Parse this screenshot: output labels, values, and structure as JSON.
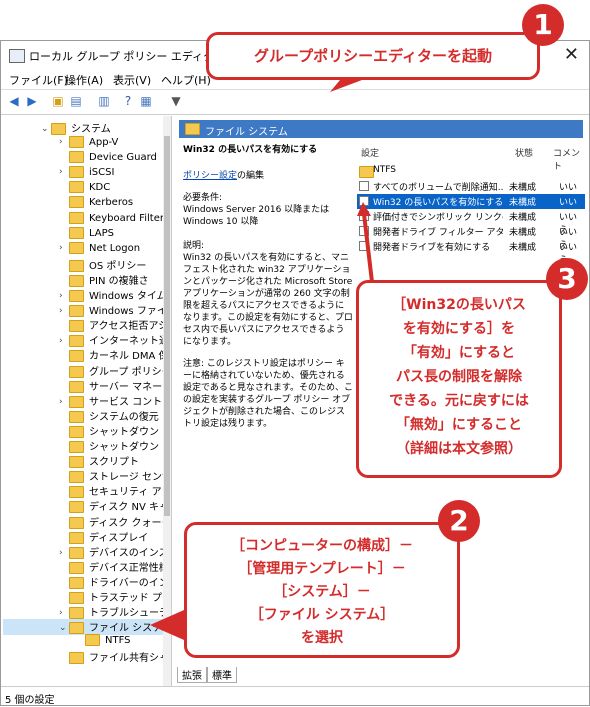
{
  "window": {
    "title": "ローカル グループ ポリシー エディター",
    "close": "✕"
  },
  "menu": [
    "ファイル(F)",
    "操作(A)",
    "表示(V)",
    "ヘルプ(H)"
  ],
  "tree": {
    "root": "システム",
    "items": [
      {
        "label": "App-V",
        "arrow": ">"
      },
      {
        "label": "Device Guard",
        "arrow": ""
      },
      {
        "label": "iSCSI",
        "arrow": ">"
      },
      {
        "label": "KDC",
        "arrow": ""
      },
      {
        "label": "Kerberos",
        "arrow": ""
      },
      {
        "label": "Keyboard Filter",
        "arrow": ""
      },
      {
        "label": "LAPS",
        "arrow": ""
      },
      {
        "label": "Net Logon",
        "arrow": ">"
      },
      {
        "label": "OS ポリシー",
        "arrow": ""
      },
      {
        "label": "PIN の複雑さ",
        "arrow": ""
      },
      {
        "label": "Windows タイム",
        "arrow": ">"
      },
      {
        "label": "Windows ファイル",
        "arrow": ">"
      },
      {
        "label": "アクセス拒否アシ",
        "arrow": ""
      },
      {
        "label": "インターネット通信",
        "arrow": ">"
      },
      {
        "label": "カーネル DMA 保",
        "arrow": ""
      },
      {
        "label": "グループ ポリシー",
        "arrow": ""
      },
      {
        "label": "サーバー マネージャ",
        "arrow": ""
      },
      {
        "label": "サービス コントロー",
        "arrow": ">"
      },
      {
        "label": "システムの復元",
        "arrow": ""
      },
      {
        "label": "シャットダウン",
        "arrow": ""
      },
      {
        "label": "シャットダウン オプ",
        "arrow": ""
      },
      {
        "label": "スクリプト",
        "arrow": ""
      },
      {
        "label": "ストレージ センサー",
        "arrow": ""
      },
      {
        "label": "セキュリティ アカウ",
        "arrow": ""
      },
      {
        "label": "ディスク NV キャッ",
        "arrow": ""
      },
      {
        "label": "ディスク クォータ",
        "arrow": ""
      },
      {
        "label": "ディスプレイ",
        "arrow": ""
      },
      {
        "label": "デバイスのインスト",
        "arrow": ">"
      },
      {
        "label": "デバイス正常性構",
        "arrow": ""
      },
      {
        "label": "ドライバーのインス",
        "arrow": ""
      },
      {
        "label": "トラステッド プラット",
        "arrow": ""
      },
      {
        "label": "トラブルシューティン",
        "arrow": ">"
      },
      {
        "label": "ファイル システム",
        "arrow": "v"
      },
      {
        "label": "NTFS",
        "arrow": ""
      },
      {
        "label": "ファイル共有シャド",
        "arrow": ""
      }
    ]
  },
  "right": {
    "header": "ファイル システム",
    "policy_title": "Win32 の長いパスを有効にする",
    "edit_link": "ポリシー設定",
    "edit_suffix": "の編集",
    "req_label": "必要条件:",
    "req_text": "Windows Server 2016 以降または Windows 10 以降",
    "desc_label": "説明:",
    "desc_text": "Win32 の長いパスを有効にすると、マニフェスト化された win32 アプリケーションとパッケージ化された Microsoft Store アプリケーションが通常の 260 文字の制限を超えるパスにアクセスできるようになります。この設定を有効にすると、プロセス内で長いパスにアクセスできるようになります。",
    "note_text": "注意: このレジストリ設定はポリシー キーに格納されていないため、優先される設定であると見なされます。そのため、この設定を実装するグループ ポリシー オブジェクトが削除された場合、このレジストリ設定は残ります。",
    "columns": [
      "設定",
      "状態",
      "コメント"
    ],
    "rows": [
      {
        "name": "NTFS",
        "state": "",
        "comment": "",
        "folder": true
      },
      {
        "name": "すべてのボリュームで削除通知...",
        "state": "未構成",
        "comment": "いいえ"
      },
      {
        "name": "Win32 の長いパスを有効にする",
        "state": "未構成",
        "comment": "いいえ",
        "selected": true
      },
      {
        "name": "評価付きでシンボリック リンクの...",
        "state": "未構成",
        "comment": "いいえ"
      },
      {
        "name": "開発者ドライブ フィルター アタ...",
        "state": "未構成",
        "comment": "いいえ"
      },
      {
        "name": "開発者ドライブを有効にする",
        "state": "未構成",
        "comment": "いいえ"
      }
    ],
    "tabs": [
      "拡張",
      "標準"
    ]
  },
  "status": "5 個の設定",
  "callouts": {
    "c1": {
      "num": "1",
      "text": "グループポリシーエディターを起動"
    },
    "c2": {
      "num": "2",
      "lines": [
        "［コンピューターの構成］－",
        "［管理用テンプレート］－",
        "［システム］－",
        "［ファイル システム］",
        "を選択"
      ]
    },
    "c3": {
      "num": "3",
      "lines": [
        "［Win32の長いパス",
        "を有効にする］を",
        "「有効」にすると",
        "パス長の制限を解除",
        "できる。元に戻すには",
        "「無効」にすること",
        "（詳細は本文参照）"
      ]
    }
  },
  "colors": {
    "accent": "#d42b2b",
    "select": "#0a64c8",
    "header": "#3d79c5"
  }
}
